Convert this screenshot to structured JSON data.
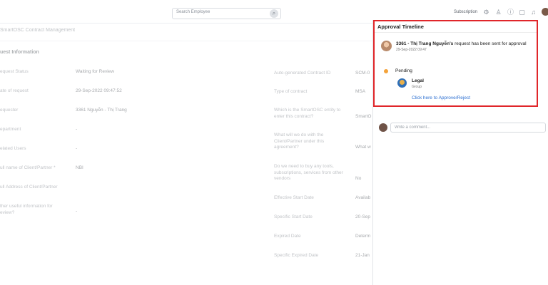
{
  "header": {
    "search_placeholder": "Search Employee",
    "subscription": "Subscription",
    "icons": [
      "gear-icon",
      "people-icon",
      "info-icon",
      "chat-icon",
      "bell-icon"
    ]
  },
  "background": {
    "breadcrumb": "SmartOSC Contract Management",
    "section_title": "uest Information",
    "left_rows": [
      {
        "label": "equest Status",
        "value": "Waiting for Review"
      },
      {
        "label": "ate of request",
        "value": "29-Sep-2022 09:47:52"
      },
      {
        "label": "equester",
        "value": "3361 Nguyễn - Thị Trang"
      },
      {
        "label": "epartment",
        "value": "-"
      },
      {
        "label": "elated Users",
        "value": "-"
      },
      {
        "label": "ull name of Client/Partner *",
        "value": "NBI"
      },
      {
        "label": "ull Address of Client/Partner",
        "value": ""
      },
      {
        "label": "ther useful information for\neview?",
        "value": "-"
      }
    ],
    "right_rows": [
      {
        "label": "Auto-generated Contract ID",
        "value": "SCM-0"
      },
      {
        "label": "Type of contract",
        "value": "MSA"
      },
      {
        "label": "Which is the SmartOSC entity to enter this contract?",
        "value": "SmartO"
      },
      {
        "label": "What will we do with the Client/Partner under this agreement?",
        "value": "What w"
      },
      {
        "label": "Do we need to buy any tools, subscriptions, services from other vendors",
        "value": "No"
      },
      {
        "label": "Effective Start Date",
        "value": "Availab"
      },
      {
        "label": "Specific Start Date",
        "value": "20-Sep"
      },
      {
        "label": "Expired Date",
        "value": "Determ"
      },
      {
        "label": "Specific Expired Date",
        "value": "21-Jan"
      }
    ]
  },
  "timeline": {
    "title": "Approval Timeline",
    "event_requester": "3361 - Thị Trang Nguyễn's",
    "event_text": " request has been sent for approval",
    "event_time": "29-Sep-2022 09:47",
    "status": "Pending",
    "approver_name": "Legal",
    "approver_type": "Group",
    "action_link": "Click here to Approve/Reject"
  },
  "comment": {
    "placeholder": "Write a comment..."
  },
  "colors": {
    "highlight_border": "#e0262a",
    "link": "#2c6fd1",
    "pending_dot": "#f4a33a"
  }
}
